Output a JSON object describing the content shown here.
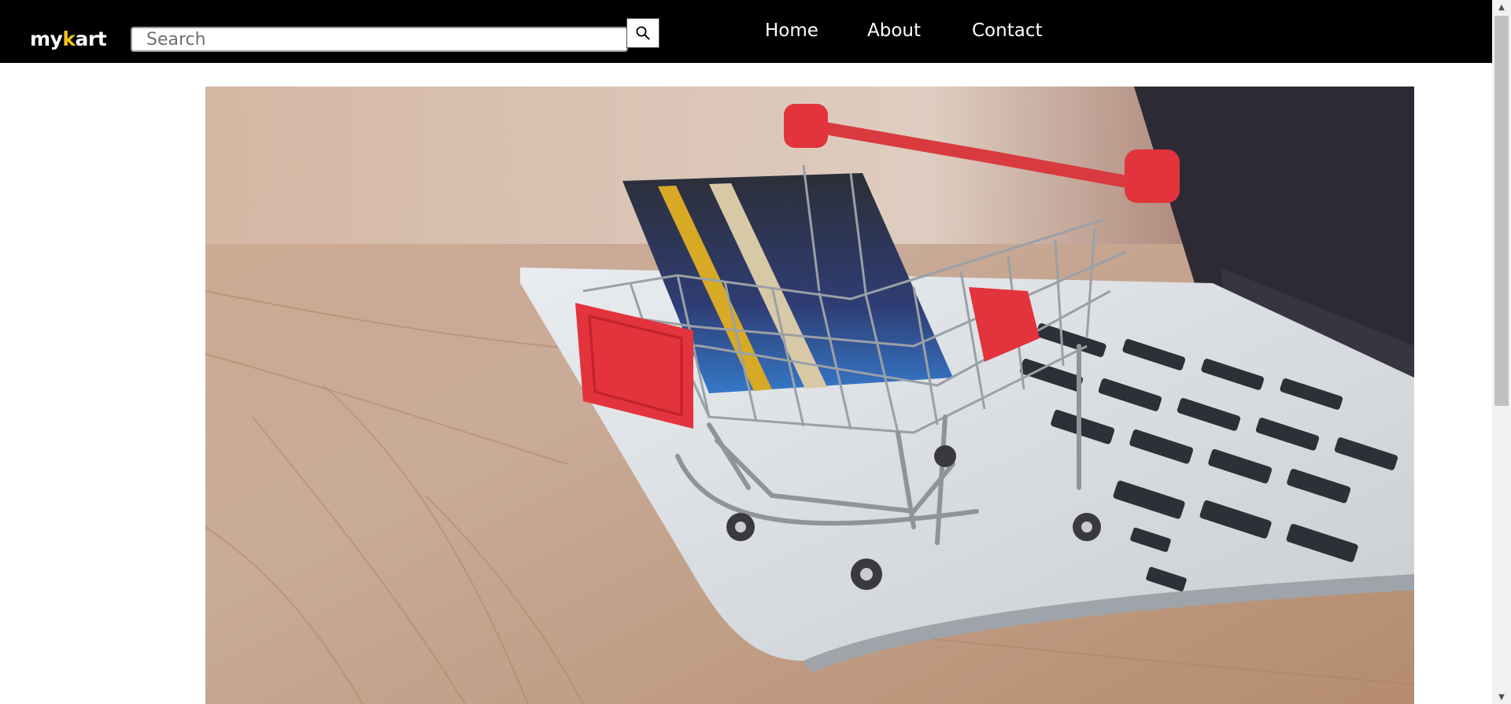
{
  "header": {
    "logo": {
      "part1": "my",
      "accent": "k",
      "part2": "art"
    },
    "search": {
      "placeholder": "Search",
      "value": ""
    },
    "search_button_icon": "search-icon",
    "nav": [
      {
        "label": "Home"
      },
      {
        "label": "About"
      },
      {
        "label": "Contact"
      }
    ]
  },
  "hero": {
    "image": "shopping-cart-credit-card-laptop-photo"
  },
  "colors": {
    "navbar_bg": "#000000",
    "logo_accent": "#f2c21b",
    "cart_red": "#e3333c",
    "page_bg": "#ffffff"
  }
}
